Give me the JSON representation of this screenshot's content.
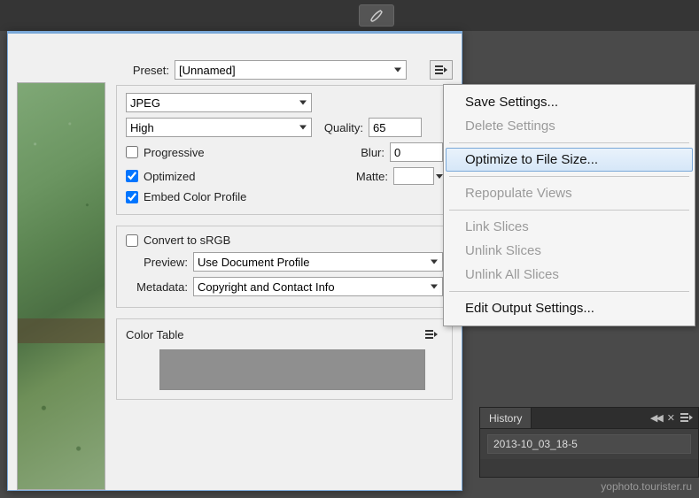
{
  "preset": {
    "label": "Preset:",
    "value": "[Unnamed]"
  },
  "format": {
    "value": "JPEG"
  },
  "quality": {
    "preset": "High",
    "label": "Quality:",
    "value": "65"
  },
  "blur": {
    "label": "Blur:",
    "value": "0"
  },
  "matte": {
    "label": "Matte:"
  },
  "checks": {
    "progressive": {
      "label": "Progressive",
      "checked": false
    },
    "optimized": {
      "label": "Optimized",
      "checked": true
    },
    "embed_profile": {
      "label": "Embed Color Profile",
      "checked": true
    },
    "convert_srgb": {
      "label": "Convert to sRGB",
      "checked": false
    }
  },
  "preview": {
    "label": "Preview:",
    "value": "Use Document Profile"
  },
  "metadata": {
    "label": "Metadata:",
    "value": "Copyright and Contact Info"
  },
  "color_table": {
    "label": "Color Table"
  },
  "menu": {
    "save": "Save Settings...",
    "delete": "Delete Settings",
    "optimize": "Optimize to File Size...",
    "repopulate": "Repopulate Views",
    "link": "Link Slices",
    "unlink": "Unlink Slices",
    "unlink_all": "Unlink All Slices",
    "edit_output": "Edit Output Settings..."
  },
  "history": {
    "tab": "History",
    "item": "2013-10_03_18-5"
  },
  "watermark": "yophoto.tourister.ru"
}
